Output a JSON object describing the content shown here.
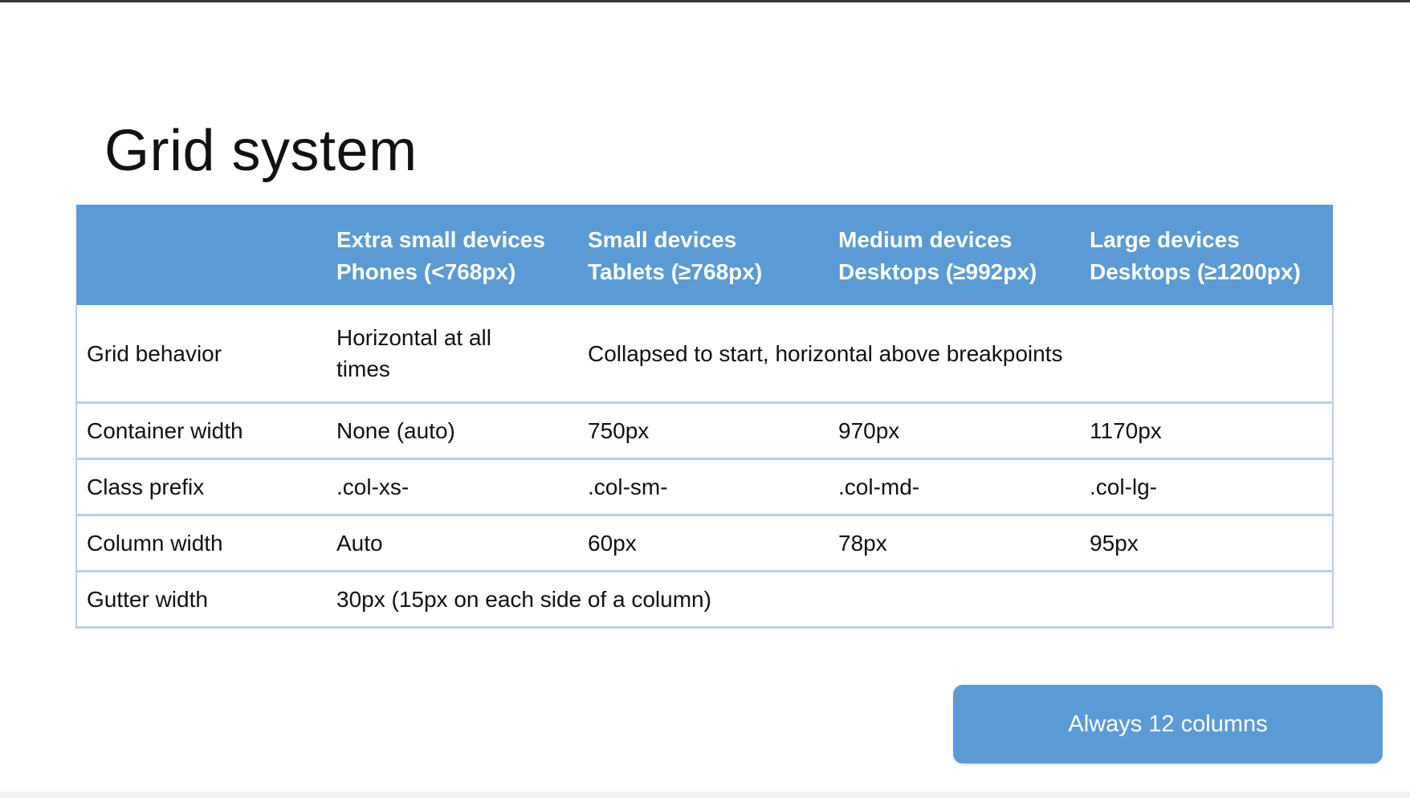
{
  "slide": {
    "title": "Grid system"
  },
  "table": {
    "header": [
      {
        "line1": "",
        "line2": ""
      },
      {
        "line1": "Extra small devices",
        "line2": "Phones (<768px)"
      },
      {
        "line1": "Small devices",
        "line2": "Tablets (≥768px)"
      },
      {
        "line1": "Medium devices",
        "line2": "Desktops (≥992px)"
      },
      {
        "line1": "Large devices",
        "line2": "Desktops (≥1200px)"
      }
    ],
    "rows": {
      "grid_behavior": {
        "label": "Grid behavior",
        "xs": "Horizontal at all times",
        "rest": "Collapsed to start, horizontal above breakpoints"
      },
      "container_width": {
        "label": "Container width",
        "xs": "None (auto)",
        "sm": "750px",
        "md": "970px",
        "lg": "1170px"
      },
      "class_prefix": {
        "label": "Class prefix",
        "xs": ".col-xs-",
        "sm": ".col-sm-",
        "md": ".col-md-",
        "lg": ".col-lg-"
      },
      "column_width": {
        "label": "Column width",
        "xs": "Auto",
        "sm": "60px",
        "md": "78px",
        "lg": "95px"
      },
      "gutter_width": {
        "label": "Gutter width",
        "value": "30px (15px on each side of a column)"
      }
    }
  },
  "callout": {
    "text": "Always 12 columns"
  },
  "colors": {
    "header_bg": "#5b9bd5",
    "header_text": "#ffffff",
    "row_border": "#b8cfe8",
    "callout_bg": "#5b9bd5"
  }
}
